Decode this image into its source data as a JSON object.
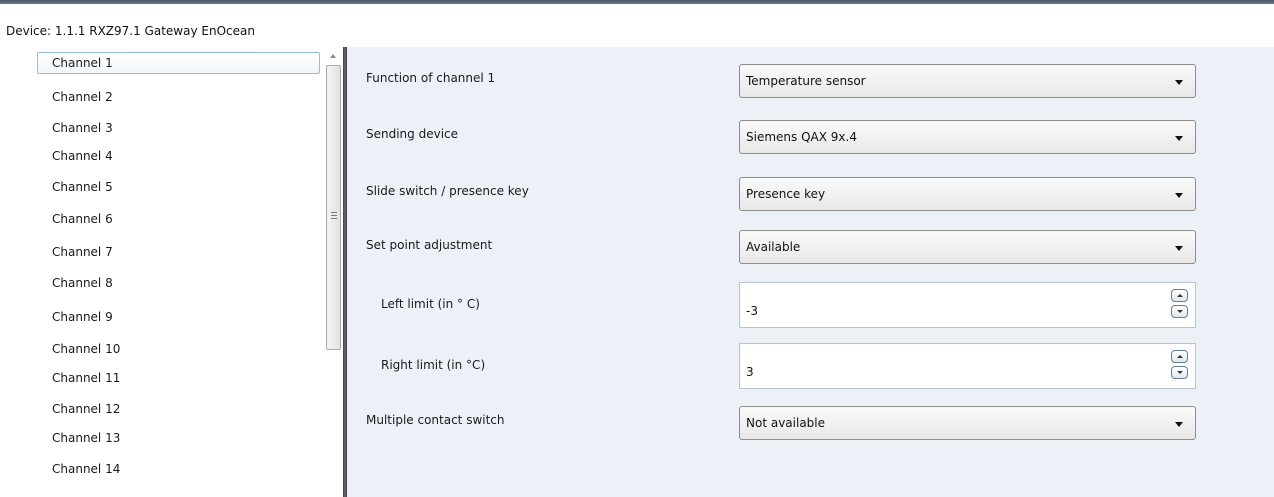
{
  "device": {
    "title": "Device: 1.1.1  RXZ97.1 Gateway EnOcean"
  },
  "channels": [
    {
      "label": "Channel 1",
      "selected": true
    },
    {
      "label": "Channel 2"
    },
    {
      "label": "Channel 3"
    },
    {
      "label": "Channel 4"
    },
    {
      "label": "Channel 5"
    },
    {
      "label": "Channel 6"
    },
    {
      "label": "Channel 7"
    },
    {
      "label": "Channel 8"
    },
    {
      "label": "Channel 9"
    },
    {
      "label": "Channel 10"
    },
    {
      "label": "Channel 11"
    },
    {
      "label": "Channel 12"
    },
    {
      "label": "Channel 13"
    },
    {
      "label": "Channel 14"
    }
  ],
  "parameters": {
    "function": {
      "label": "Function of channel 1",
      "value": "Temperature sensor"
    },
    "sending_device": {
      "label": "Sending device",
      "value": "Siemens QAX 9x.4"
    },
    "slide_switch": {
      "label": "Slide switch / presence key",
      "value": "Presence key"
    },
    "set_point": {
      "label": "Set point adjustment",
      "value": "Available"
    },
    "left_limit": {
      "label": "Left limit   (in ° C)",
      "value": "-3"
    },
    "right_limit": {
      "label": "Right limit   (in °C)",
      "value": "3"
    },
    "multiple_contact": {
      "label": "Multiple contact switch",
      "value": "Not available"
    }
  },
  "icons": {
    "dropdown_arrow": "chevron-down-icon",
    "spin_up": "spin-up-icon",
    "spin_down": "spin-down-icon",
    "scroll_up": "scroll-up-arrow-icon"
  },
  "colors": {
    "right_panel_bg": "#ebf1f7",
    "selection_border": "#9bbad8",
    "splitter": "#4a4a4a"
  }
}
